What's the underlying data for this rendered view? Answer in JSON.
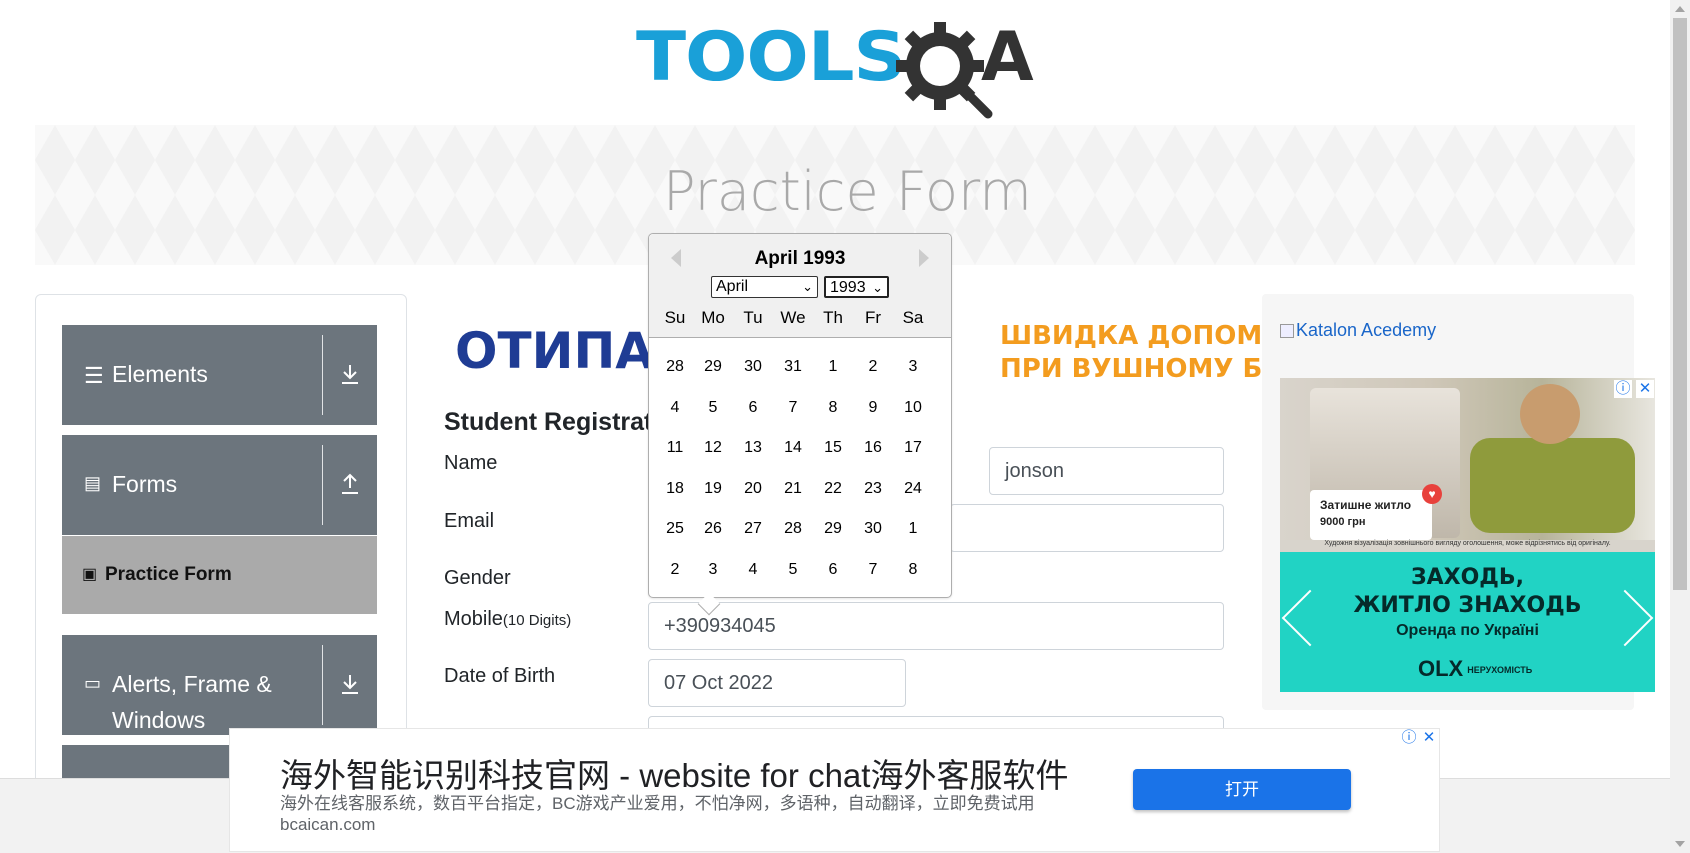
{
  "header": {
    "logo_text": "TOOLS",
    "logo_suffix": "A",
    "logo_color": "#1aa0d8"
  },
  "banner": {
    "title": "Practice Form"
  },
  "sidebar": {
    "groups": [
      {
        "label": "Elements",
        "icon": "hamburger-icon",
        "arrow": "download-icon"
      },
      {
        "label": "Forms",
        "icon": "document-icon",
        "arrow": "upload-icon"
      },
      {
        "label": "Alerts, Frame &",
        "label2": "Windows",
        "icon": "window-icon",
        "arrow": "download-icon"
      }
    ],
    "active_item": {
      "label": "Practice Form",
      "icon": "html5-icon"
    },
    "group_color": "#6c757d",
    "active_color": "#aaaaaa"
  },
  "ad_strip": {
    "left_text": "ОТИПА",
    "right_line1": "ШВИДКА ДОПОМ",
    "right_line2": "ПРИ ВУШНОМУ Б"
  },
  "form": {
    "title": "Student Registratio",
    "labels": {
      "name": "Name",
      "email": "Email",
      "gender": "Gender",
      "mobile": "Mobile",
      "mobile_hint": "(10 Digits)",
      "dob": "Date of Birth"
    },
    "last_name_value": "jonson",
    "email_value": "",
    "mobile_value": "+390934045",
    "dob_value": "07 Oct 2022"
  },
  "datepicker": {
    "current_month": "April 1993",
    "month_select": "April",
    "year_select": "1993",
    "weekdays": [
      "Su",
      "Mo",
      "Tu",
      "We",
      "Th",
      "Fr",
      "Sa"
    ],
    "weeks": [
      [
        "28",
        "29",
        "30",
        "31",
        "1",
        "2",
        "3"
      ],
      [
        "4",
        "5",
        "6",
        "7",
        "8",
        "9",
        "10"
      ],
      [
        "11",
        "12",
        "13",
        "14",
        "15",
        "16",
        "17"
      ],
      [
        "18",
        "19",
        "20",
        "21",
        "22",
        "23",
        "24"
      ],
      [
        "25",
        "26",
        "27",
        "28",
        "29",
        "30",
        "1"
      ],
      [
        "2",
        "3",
        "4",
        "5",
        "6",
        "7",
        "8"
      ]
    ]
  },
  "right_ad": {
    "katalon_alt": "Katalon Acedemy",
    "card_title": "Затишне житло",
    "card_price": "9000 грн",
    "fine_print": "Художня візуалізація зовнішнього вигляду оголошення, може відрізнятись від оригіналу.",
    "headline1": "ЗАХОДЬ,",
    "headline2": "ЖИТЛО ЗНАХОДЬ",
    "subline": "Оренда по Україні",
    "brand": "OLX",
    "brand_sub": "НЕРУХОМІСТЬ"
  },
  "bottom_ad": {
    "title": "海外智能识别科技官网 - website for chat海外客服软件",
    "description": "海外在线客服系统，数百平台指定，BC游戏产业爱用，不怕净网，多语种，自动翻译，立即免费试用 bcaican.com",
    "button_label": "打开",
    "button_color": "#1a73e8"
  }
}
